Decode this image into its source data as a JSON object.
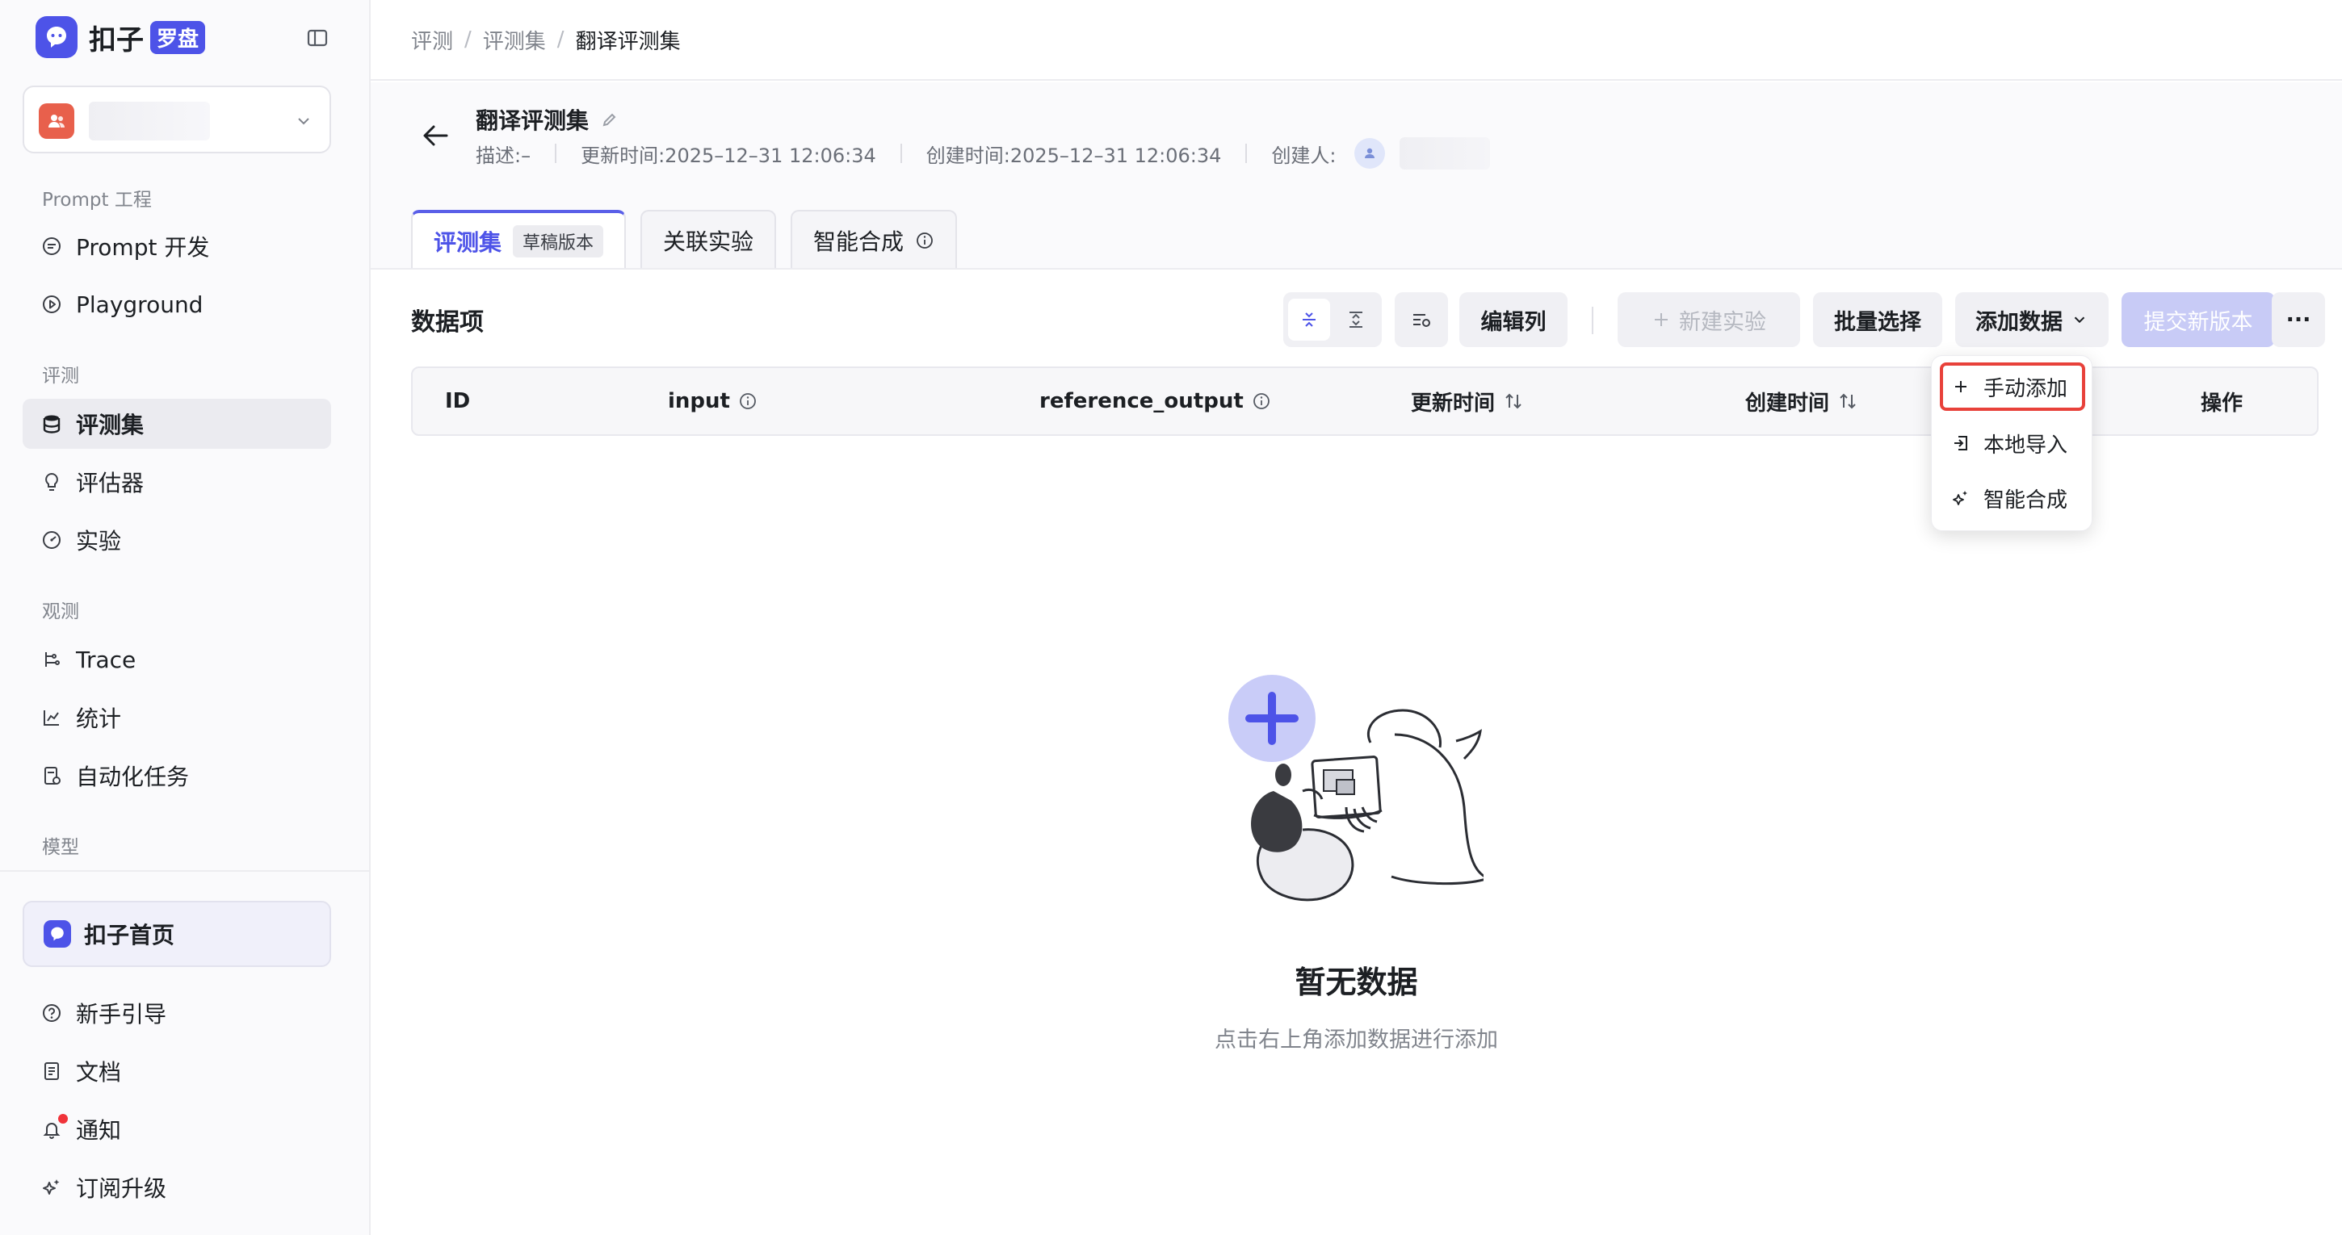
{
  "brand": {
    "name": "扣子",
    "tag": "罗盘"
  },
  "sidebar": {
    "groups": {
      "prompt": "Prompt 工程",
      "eval": "评测",
      "observe": "观测",
      "model": "模型"
    },
    "items": {
      "prompt_dev": "Prompt 开发",
      "playground": "Playground",
      "eval_set": "评测集",
      "evaluator": "评估器",
      "experiment": "实验",
      "trace": "Trace",
      "stats": "统计",
      "automation": "自动化任务"
    },
    "home": "扣子首页",
    "bottom": {
      "guide": "新手引导",
      "docs": "文档",
      "notice": "通知",
      "upgrade": "订阅升级"
    }
  },
  "breadcrumb": [
    "评测",
    "评测集",
    "翻译评测集"
  ],
  "dataset": {
    "title": "翻译评测集",
    "desc": "描述:–",
    "updated": "更新时间:2025–12–31 12:06:34",
    "created": "创建时间:2025–12–31 12:06:34",
    "creator_label": "创建人:"
  },
  "tabs": {
    "eval_set": "评测集",
    "draft_badge": "草稿版本",
    "linked_exp": "关联实验",
    "smart_synth": "智能合成"
  },
  "section_title": "数据项",
  "toolbar": {
    "edit_columns": "编辑列",
    "new_experiment": "新建实验",
    "batch_select": "批量选择",
    "add_data": "添加数据",
    "submit_version": "提交新版本",
    "more": "···"
  },
  "table": {
    "headers": [
      "ID",
      "input",
      "reference_output",
      "更新时间",
      "创建时间",
      "操作"
    ]
  },
  "dropdown": {
    "manual_add": "手动添加",
    "local_import": "本地导入",
    "smart_synth": "智能合成"
  },
  "empty": {
    "title": "暂无数据",
    "desc": "点击右上角添加数据进行添加"
  },
  "colors": {
    "accent": "#4d53e8",
    "highlight_border": "#e8413a",
    "workspace_avatar": "#e8604c"
  }
}
